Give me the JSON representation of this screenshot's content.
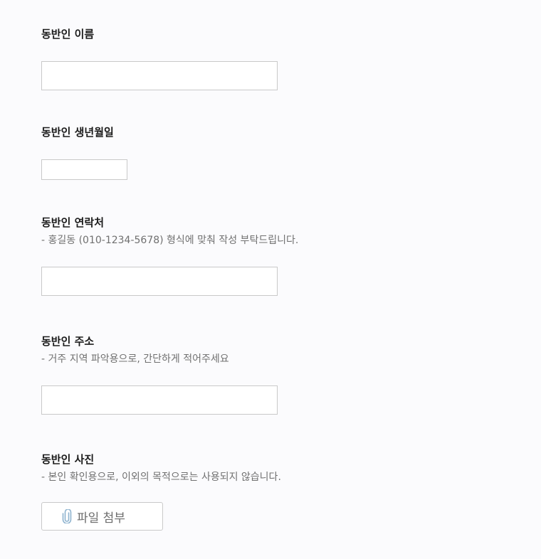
{
  "fields": {
    "name": {
      "label": "동반인 이름",
      "value": ""
    },
    "birthdate": {
      "label": "동반인 생년월일",
      "value": ""
    },
    "phone": {
      "label": "동반인 연락처",
      "help": "- 홍길동 (010-1234-5678) 형식에 맞춰 작성 부탁드립니다.",
      "value": ""
    },
    "address": {
      "label": "동반인 주소",
      "help": "- 거주 지역 파악용으로, 간단하게 적어주세요",
      "value": ""
    },
    "photo": {
      "label": "동반인 사진",
      "help": "- 본인 확인용으로, 이외의 목적으로는 사용되지 않습니다.",
      "button_label": "파일 첨부",
      "button_icon": "paperclip-icon"
    }
  },
  "colors": {
    "background": "#fbfbfd",
    "label_text": "#1b1b1b",
    "help_text": "#707070",
    "input_border": "#c9c9c9",
    "clip_icon": "#8eb3cf"
  }
}
